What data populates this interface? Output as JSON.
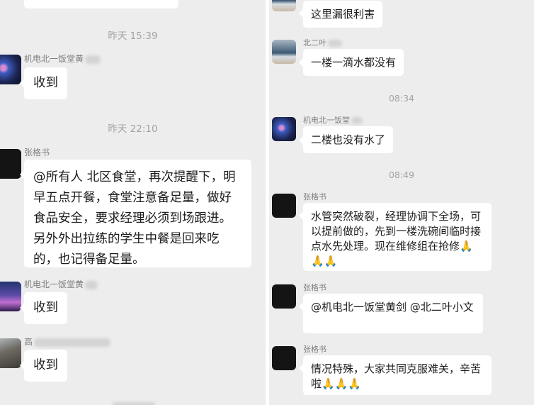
{
  "left": {
    "timestamp_1": "昨天 15:39",
    "timestamp_2": "昨天 22:10",
    "messages": [
      {
        "sender": "机电北一饭堂黄",
        "text": "收到"
      },
      {
        "sender": "张格书",
        "text": "@所有人 北区食堂，再次提醒下，明早五点开餐，食堂注意备足量，做好食品安全，要求经理必须到场跟进。另外外出拉练的学生中餐是回来吃的，也记得备足量。"
      },
      {
        "sender": "机电北一饭堂黄",
        "text": "收到"
      },
      {
        "sender": "高",
        "text": "收到"
      }
    ]
  },
  "right": {
    "messages_a": [
      {
        "sender": "",
        "text": "这里漏很利害"
      },
      {
        "sender": "北二叶",
        "text": "一楼一滴水都没有"
      }
    ],
    "timestamp_1": "08:34",
    "message_b": {
      "sender": "机电北一饭堂",
      "text": "二楼也没有水了"
    },
    "timestamp_2": "08:49",
    "messages_c": [
      {
        "sender": "张格书",
        "text": "水管突然破裂，经理协调下全场，可以提前做的，先到一楼洗碗间临时接点水先处理。现在维修组在抢修🙏🙏🙏"
      },
      {
        "sender": "张格书",
        "text": "@机电北一饭堂黄剑 @北二叶小文"
      },
      {
        "sender": "张格书",
        "text": "情况特殊，大家共同克服难关，辛苦啦🙏🙏🙏"
      }
    ]
  }
}
